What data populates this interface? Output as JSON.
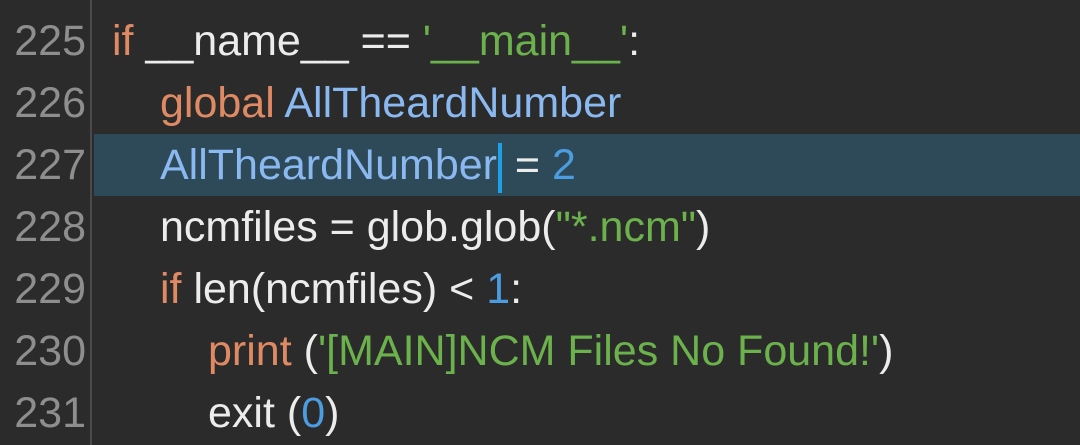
{
  "editor": {
    "current_line": 227,
    "lines": [
      {
        "number": "225",
        "tokens": [
          {
            "text": "if",
            "kind": "keyword"
          },
          {
            "text": " __name__ == ",
            "kind": "plain"
          },
          {
            "text": "'__main__'",
            "kind": "string"
          },
          {
            "text": ":",
            "kind": "plain"
          }
        ]
      },
      {
        "number": "226",
        "tokens": [
          {
            "text": "global",
            "kind": "keyword"
          },
          {
            "text": " ",
            "kind": "plain"
          },
          {
            "text": "AllTheardNumber",
            "kind": "identifier"
          }
        ]
      },
      {
        "number": "227",
        "tokens": [
          {
            "text": "AllTheardNumber",
            "kind": "identifier"
          },
          {
            "text": " = ",
            "kind": "plain"
          },
          {
            "text": "2",
            "kind": "number"
          }
        ]
      },
      {
        "number": "228",
        "tokens": [
          {
            "text": "ncmfiles = glob.glob(",
            "kind": "plain"
          },
          {
            "text": "\"*.ncm\"",
            "kind": "string"
          },
          {
            "text": ")",
            "kind": "plain"
          }
        ]
      },
      {
        "number": "229",
        "tokens": [
          {
            "text": "if",
            "kind": "keyword"
          },
          {
            "text": " len(ncmfiles) < ",
            "kind": "plain"
          },
          {
            "text": "1",
            "kind": "number"
          },
          {
            "text": ":",
            "kind": "plain"
          }
        ]
      },
      {
        "number": "230",
        "tokens": [
          {
            "text": "print",
            "kind": "function"
          },
          {
            "text": " (",
            "kind": "plain"
          },
          {
            "text": "'[MAIN]NCM Files No Found!'",
            "kind": "string"
          },
          {
            "text": ")",
            "kind": "plain"
          }
        ]
      },
      {
        "number": "231",
        "tokens": [
          {
            "text": "exit (",
            "kind": "plain"
          },
          {
            "text": "0",
            "kind": "number"
          },
          {
            "text": ")",
            "kind": "plain"
          }
        ]
      }
    ]
  },
  "colors": {
    "background": "#2b2b2b",
    "current_line": "#2e4a58",
    "keyword": "#e08a64",
    "identifier": "#8ab8f0",
    "string": "#6cb24c",
    "number": "#4b9ce0",
    "plain": "#ececec",
    "line_number": "#8e8e8e",
    "cursor": "#1e9fe6"
  }
}
